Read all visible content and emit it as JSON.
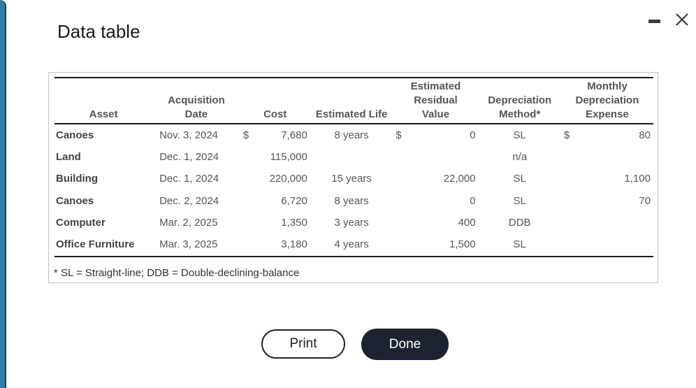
{
  "dialog": {
    "title": "Data table",
    "minimize_icon": "minimize-icon",
    "close_icon": "close-icon"
  },
  "table": {
    "headers": {
      "asset": "Asset",
      "acq_line1": "Acquisition",
      "acq_line2": "Date",
      "cost": "Cost",
      "life": "Estimated Life",
      "resid_line1": "Estimated",
      "resid_line2": "Residual",
      "resid_line3": "Value",
      "method_line1": "Depreciation",
      "method_line2": "Method*",
      "monthly_line1": "Monthly",
      "monthly_line2": "Depreciation",
      "monthly_line3": "Expense"
    },
    "rows": [
      {
        "asset": "Canoes",
        "date": "Nov. 3, 2024",
        "cost_cur": "$",
        "cost": "7,680",
        "life": "8 years",
        "resid_cur": "$",
        "residual": "0",
        "method": "SL",
        "exp_cur": "$",
        "expense": "80"
      },
      {
        "asset": "Land",
        "date": "Dec. 1, 2024",
        "cost_cur": "",
        "cost": "115,000",
        "life": "",
        "resid_cur": "",
        "residual": "",
        "method": "n/a",
        "exp_cur": "",
        "expense": ""
      },
      {
        "asset": "Building",
        "date": "Dec. 1, 2024",
        "cost_cur": "",
        "cost": "220,000",
        "life": "15 years",
        "resid_cur": "",
        "residual": "22,000",
        "method": "SL",
        "exp_cur": "",
        "expense": "1,100"
      },
      {
        "asset": "Canoes",
        "date": "Dec. 2, 2024",
        "cost_cur": "",
        "cost": "6,720",
        "life": "8 years",
        "resid_cur": "",
        "residual": "0",
        "method": "SL",
        "exp_cur": "",
        "expense": "70"
      },
      {
        "asset": "Computer",
        "date": "Mar. 2, 2025",
        "cost_cur": "",
        "cost": "1,350",
        "life": "3 years",
        "resid_cur": "",
        "residual": "400",
        "method": "DDB",
        "exp_cur": "",
        "expense": ""
      },
      {
        "asset": "Office Furniture",
        "date": "Mar. 3, 2025",
        "cost_cur": "",
        "cost": "3,180",
        "life": "4 years",
        "resid_cur": "",
        "residual": "1,500",
        "method": "SL",
        "exp_cur": "",
        "expense": ""
      }
    ],
    "footnote": "* SL = Straight-line; DDB = Double-declining-balance"
  },
  "buttons": {
    "print": "Print",
    "done": "Done"
  }
}
